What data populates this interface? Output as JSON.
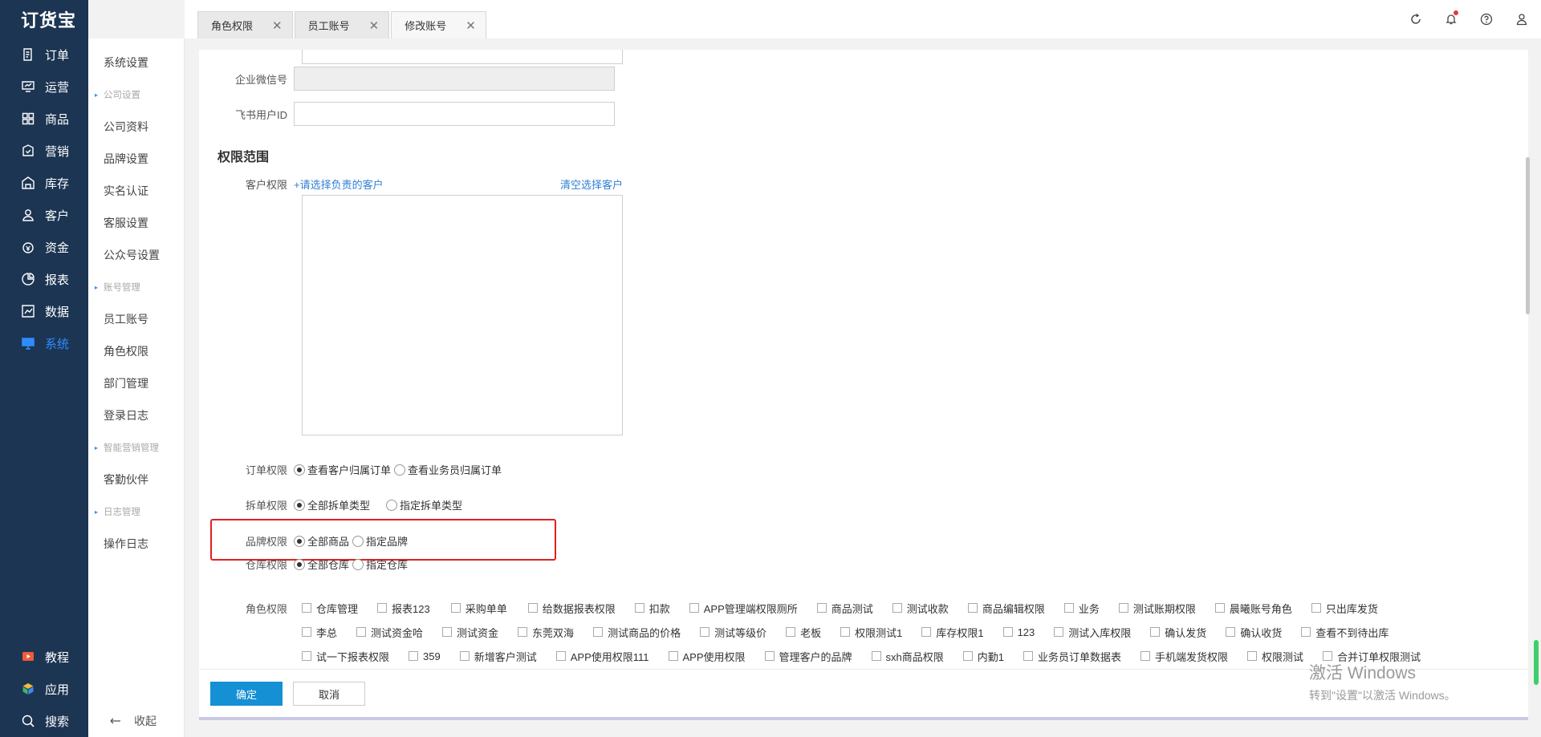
{
  "logo": "订货宝",
  "nav": {
    "items": [
      {
        "label": "订单",
        "icon": "order-icon"
      },
      {
        "label": "运营",
        "icon": "operation-icon"
      },
      {
        "label": "商品",
        "icon": "goods-icon"
      },
      {
        "label": "营销",
        "icon": "marketing-icon"
      },
      {
        "label": "库存",
        "icon": "warehouse-icon"
      },
      {
        "label": "客户",
        "icon": "customer-icon"
      },
      {
        "label": "资金",
        "icon": "money-icon"
      },
      {
        "label": "报表",
        "icon": "report-icon"
      },
      {
        "label": "数据",
        "icon": "data-icon"
      },
      {
        "label": "系统",
        "icon": "system-icon"
      }
    ],
    "bottom": [
      {
        "label": "教程",
        "icon": "tutorial-icon"
      },
      {
        "label": "应用",
        "icon": "apps-icon"
      },
      {
        "label": "搜索",
        "icon": "search-icon"
      }
    ],
    "accent": "#2f8cff"
  },
  "submenu": {
    "items": [
      "系统设置",
      "公司设置",
      "公司资料",
      "品牌设置",
      "实名认证",
      "客服设置",
      "公众号设置",
      "账号管理",
      "员工账号",
      "角色权限",
      "部门管理",
      "登录日志",
      "智能营销管理",
      "客勤伙伴",
      "日志管理",
      "操作日志"
    ],
    "collapse": "收起"
  },
  "tabs": [
    {
      "label": "角色权限"
    },
    {
      "label": "员工账号"
    },
    {
      "label": "修改账号"
    }
  ],
  "form": {
    "wechat_label": "企业微信号",
    "feishu_label": "飞书用户ID",
    "section_title": "权限范围",
    "customer_label": "客户权限",
    "customer_add": "+请选择负责的客户",
    "customer_clear": "清空选择客户",
    "order_label": "订单权限",
    "order_opt1": "查看客户归属订单",
    "order_opt2": "查看业务员归属订单",
    "split_label": "拆单权限",
    "split_opt1": "全部拆单类型",
    "split_opt2": "指定拆单类型",
    "brand_label": "品牌权限",
    "brand_opt1": "全部商品",
    "brand_opt2": "指定品牌",
    "warehouse_label": "仓库权限",
    "warehouse_opt1": "全部仓库",
    "warehouse_opt2": "指定仓库",
    "role_label": "角色权限",
    "roles_row1": [
      "仓库管理",
      "报表123",
      "采购单单",
      "给数据报表权限",
      "扣款",
      "APP管理端权限厕所",
      "商品测试",
      "测试收款",
      "商品编辑权限",
      "业务",
      "测试账期权限",
      "晨曦账号角色",
      "只出库发货"
    ],
    "roles_row2": [
      "李总",
      "测试资金哈",
      "测试资金",
      "东莞双海",
      "测试商品的价格",
      "测试等级价",
      "老板",
      "权限测试1",
      "库存权限1",
      "123",
      "测试入库权限",
      "确认发货",
      "确认收货",
      "查看不到待出库"
    ],
    "roles_row3": [
      "试一下报表权限",
      "359",
      "新增客户测试",
      "APP使用权限111",
      "APP使用权限",
      "管理客户的品牌",
      "sxh商品权限",
      "内勤1",
      "业务员订单数据表",
      "手机端发货权限",
      "权限测试",
      "合并订单权限测试"
    ]
  },
  "buttons": {
    "ok": "确定",
    "cancel": "取消"
  },
  "watermark": {
    "line1": "激活 Windows",
    "line2": "转到\"设置\"以激活 Windows。"
  }
}
